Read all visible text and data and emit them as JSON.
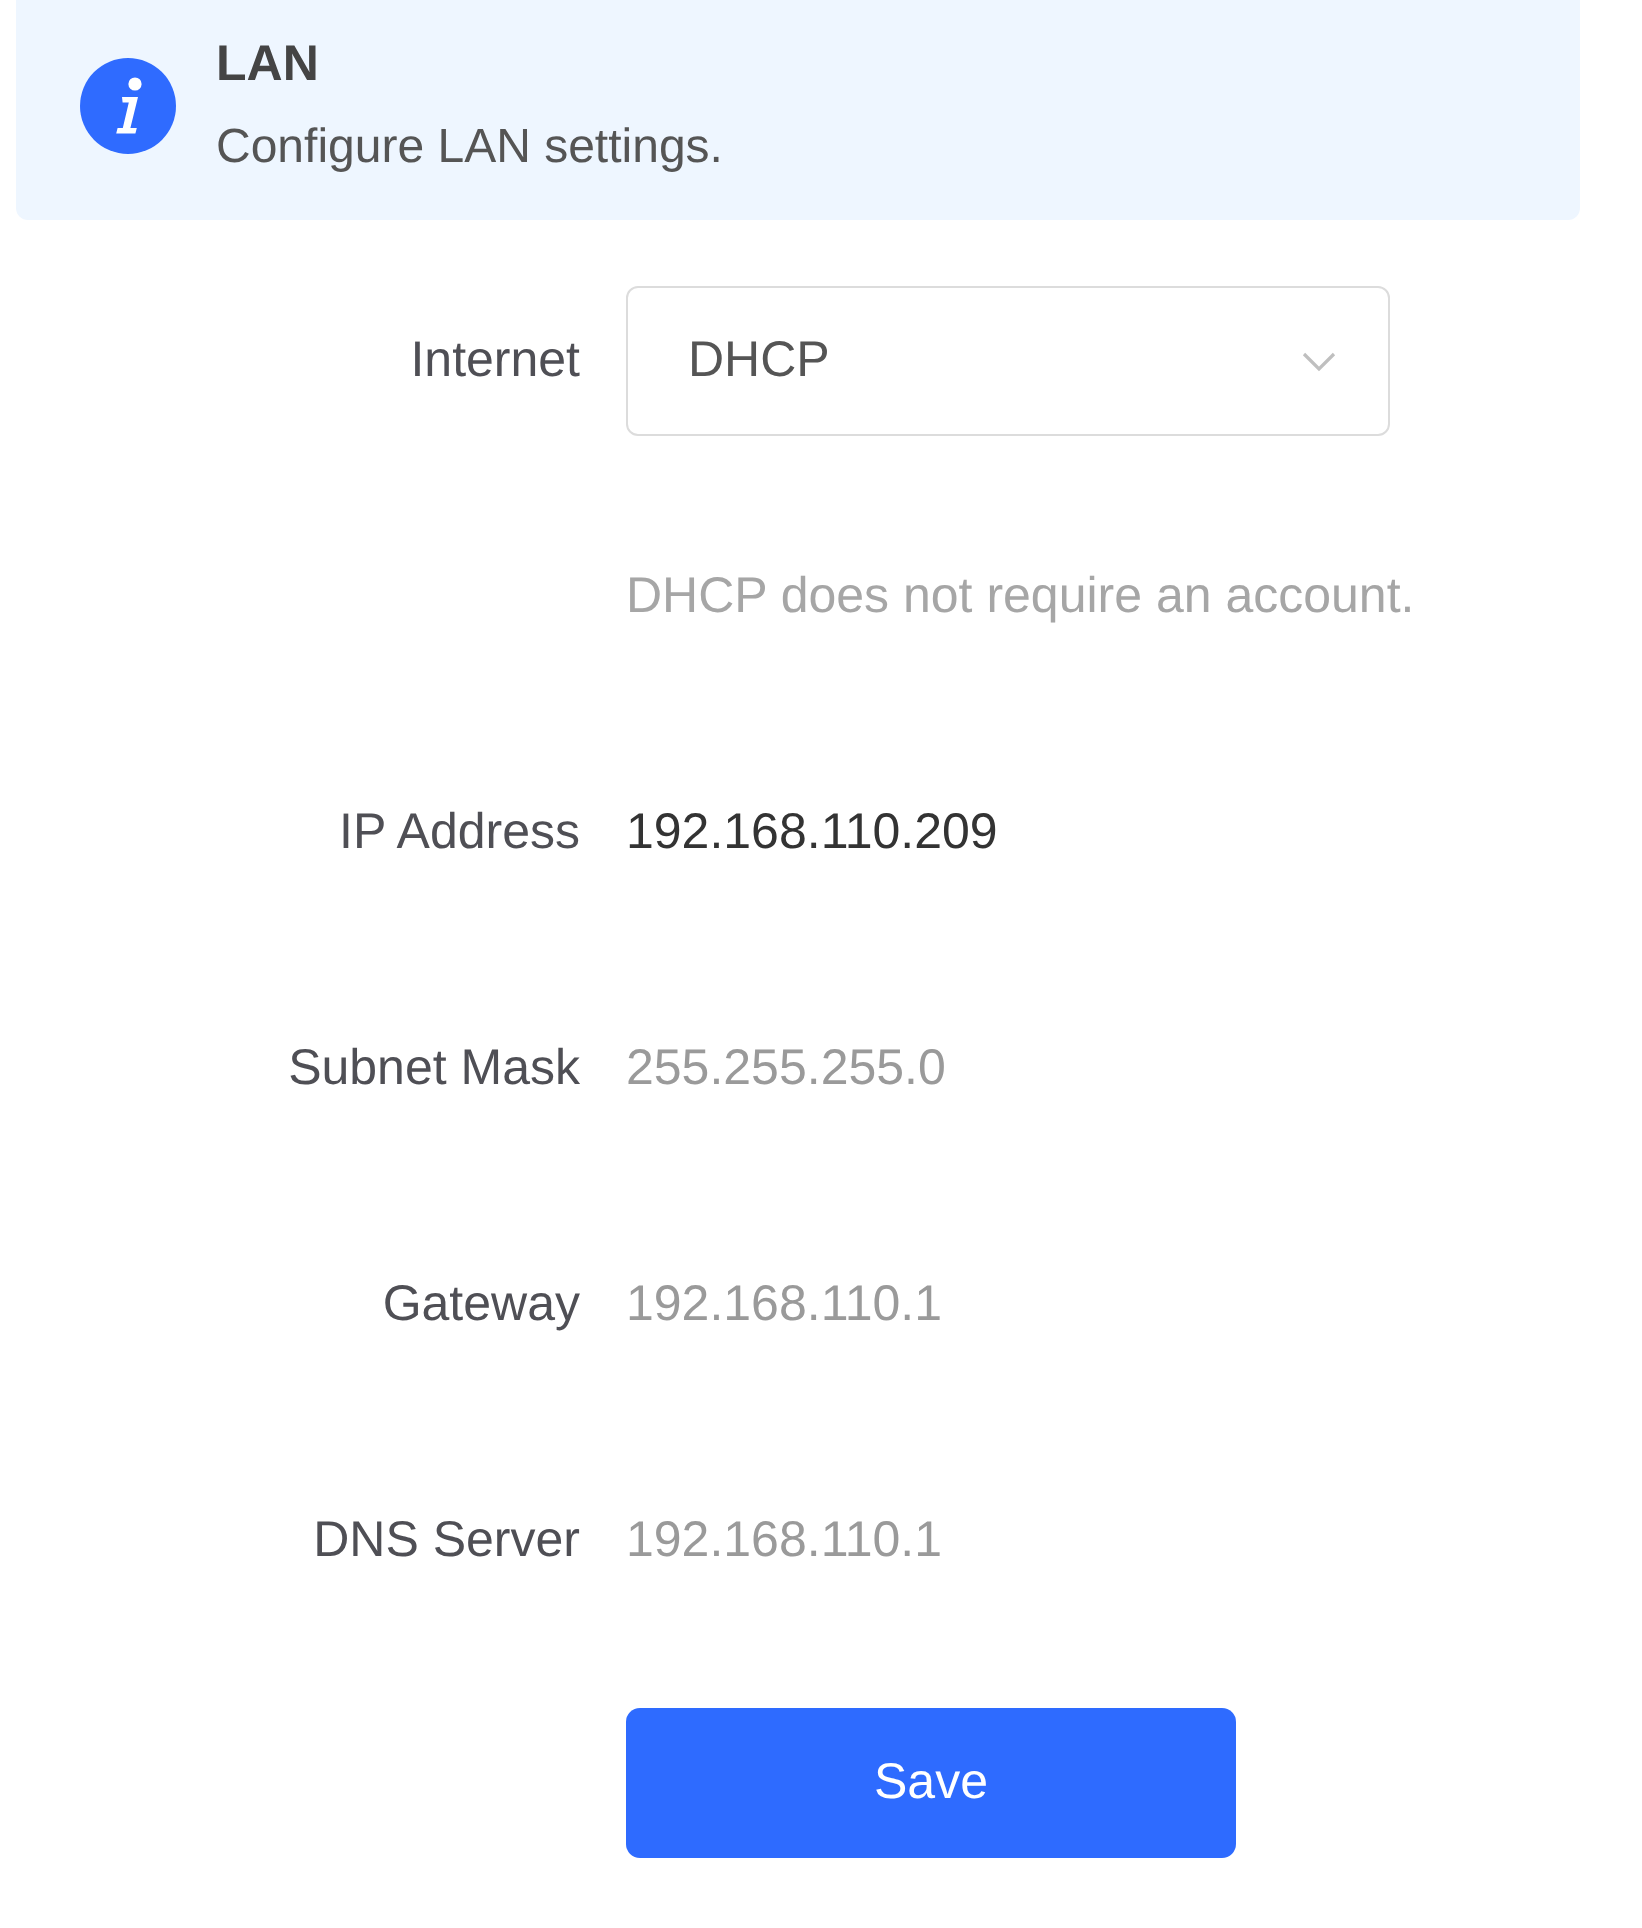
{
  "banner": {
    "title": "LAN",
    "description": "Configure LAN settings."
  },
  "form": {
    "rows": [
      {
        "kind": "select",
        "label": "Internet",
        "value": "DHCP",
        "disabled": false,
        "hint": "DHCP does not require an account."
      },
      {
        "kind": "text",
        "label": "IP Address",
        "value": "192.168.110.209",
        "disabled": false
      },
      {
        "kind": "text",
        "label": "Subnet Mask",
        "value": "255.255.255.0",
        "disabled": true
      },
      {
        "kind": "text",
        "label": "Gateway",
        "value": "192.168.110.1",
        "disabled": true
      },
      {
        "kind": "text",
        "label": "DNS Server",
        "value": "192.168.110.1",
        "disabled": true
      }
    ]
  },
  "save_button": {
    "label": "Save"
  }
}
